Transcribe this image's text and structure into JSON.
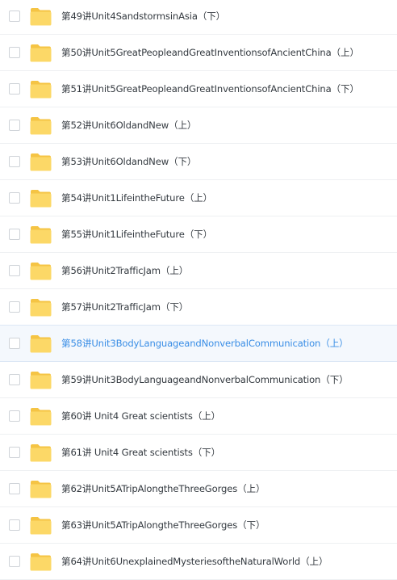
{
  "colors": {
    "folder": "#fcd867",
    "folder_tab": "#f5c444",
    "text": "#343a40",
    "selected_text": "#3a8ee6",
    "selected_bg": "#f4f8fd"
  },
  "files": [
    {
      "name": "第49讲Unit4SandstormsinAsia（下）",
      "icon": "folder-icon",
      "selected": false
    },
    {
      "name": "第50讲Unit5GreatPeopleandGreatInventionsofAncientChina（上）",
      "icon": "folder-icon",
      "selected": false
    },
    {
      "name": "第51讲Unit5GreatPeopleandGreatInventionsofAncientChina（下）",
      "icon": "folder-icon",
      "selected": false
    },
    {
      "name": "第52讲Unit6OldandNew（上）",
      "icon": "folder-icon",
      "selected": false
    },
    {
      "name": "第53讲Unit6OldandNew（下）",
      "icon": "folder-icon",
      "selected": false
    },
    {
      "name": "第54讲Unit1LifeintheFuture（上）",
      "icon": "folder-icon",
      "selected": false
    },
    {
      "name": "第55讲Unit1LifeintheFuture（下）",
      "icon": "folder-icon",
      "selected": false
    },
    {
      "name": "第56讲Unit2TrafficJam（上）",
      "icon": "folder-icon",
      "selected": false
    },
    {
      "name": "第57讲Unit2TrafficJam（下）",
      "icon": "folder-icon",
      "selected": false
    },
    {
      "name": "第58讲Unit3BodyLanguageandNonverbalCommunication（上）",
      "icon": "folder-icon",
      "selected": true
    },
    {
      "name": "第59讲Unit3BodyLanguageandNonverbalCommunication（下）",
      "icon": "folder-icon",
      "selected": false
    },
    {
      "name": "第60讲 Unit4 Great scientists（上）",
      "icon": "folder-icon",
      "selected": false
    },
    {
      "name": "第61讲 Unit4 Great scientists（下）",
      "icon": "folder-icon",
      "selected": false
    },
    {
      "name": "第62讲Unit5ATripAlongtheThreeGorges（上）",
      "icon": "folder-icon",
      "selected": false
    },
    {
      "name": "第63讲Unit5ATripAlongtheThreeGorges（下）",
      "icon": "folder-icon",
      "selected": false
    },
    {
      "name": "第64讲Unit6UnexplainedMysteriesoftheNaturalWorld（上）",
      "icon": "folder-icon",
      "selected": false
    }
  ]
}
